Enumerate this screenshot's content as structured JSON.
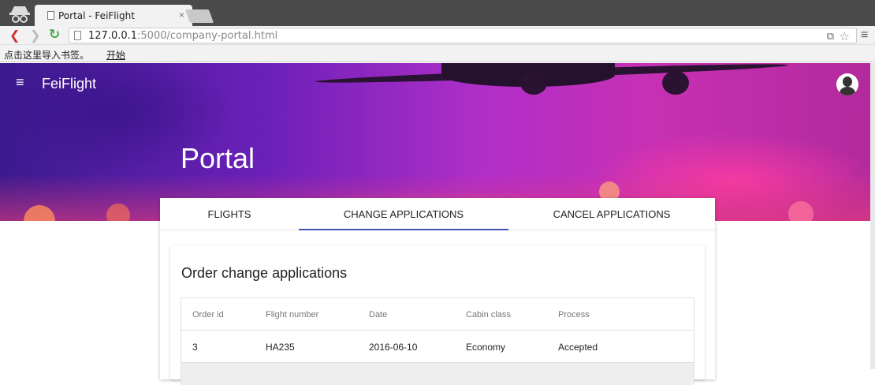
{
  "browser": {
    "tab_title": "Portal - FeiFlight",
    "tab_close": "×",
    "url_host": "127.0.0.1",
    "url_rest": ":5000/company-portal.html",
    "bookmark_hint": "点击这里导入书签。",
    "bookmark_start": "开始"
  },
  "header": {
    "brand": "FeiFlight",
    "title": "Portal"
  },
  "tabs": [
    {
      "label": "FLIGHTS",
      "active": false
    },
    {
      "label": "CHANGE APPLICATIONS",
      "active": true
    },
    {
      "label": "CANCEL APPLICATIONS",
      "active": false
    }
  ],
  "section": {
    "title": "Order change applications"
  },
  "table": {
    "columns": [
      "Order id",
      "Flight number",
      "Date",
      "Cabin class",
      "Process"
    ],
    "rows": [
      [
        "3",
        "HA235",
        "2016-06-10",
        "Economy",
        "Accepted"
      ]
    ]
  },
  "colors": {
    "accent": "#3f51b5",
    "hero_purple": "#6a20b8",
    "hero_pink": "#c730b4"
  }
}
